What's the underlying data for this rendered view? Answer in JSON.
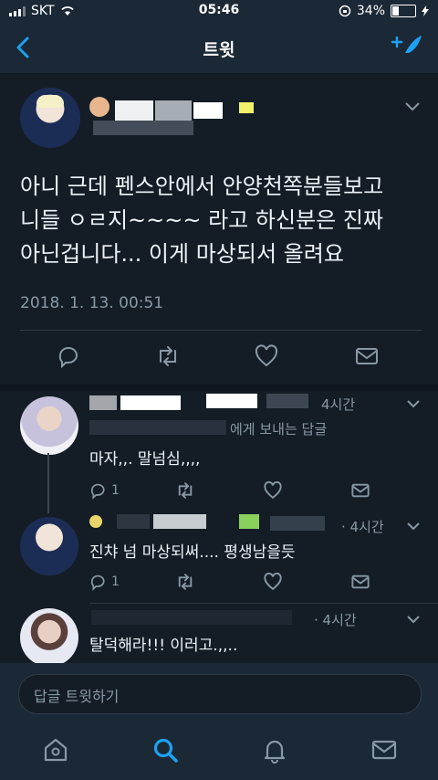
{
  "status_bar": {
    "carrier": "SKT",
    "time": "05:46",
    "battery": "34%",
    "battery_level": 0.34
  },
  "nav": {
    "title": "트윗"
  },
  "tweet": {
    "lines": [
      "아니 근데 펜스안에서 안양천쪽분들보고",
      "니들 ㅇㄹ지~~~~ 라고 하신분은 진짜",
      "아닌겁니다... 이게 마상되서 올려요"
    ],
    "timestamp": "2018. 1. 13. 00:51"
  },
  "replies": [
    {
      "time": "4시간",
      "reply_to": "에게 보내는 답글",
      "text": "마자,,. 말넘심,,,,",
      "reply_count": "1"
    },
    {
      "time": "· 4시간",
      "text": "진챠 넘 마상되써.... 평생남을듯",
      "reply_count": "1"
    },
    {
      "time": "· 4시간",
      "text": "탈덕해라!!! 이러고.,,.."
    }
  ],
  "composer": {
    "placeholder": "답글 트윗하기"
  },
  "colors": {
    "accent": "#1da1f2",
    "background": "#141d26",
    "bar": "#1b2836",
    "secondary_text": "#8899a6"
  },
  "icons": [
    "back-icon",
    "compose-icon",
    "reply-icon",
    "retweet-icon",
    "like-icon",
    "dm-icon",
    "home-icon",
    "search-icon",
    "notifications-icon",
    "messages-icon"
  ]
}
